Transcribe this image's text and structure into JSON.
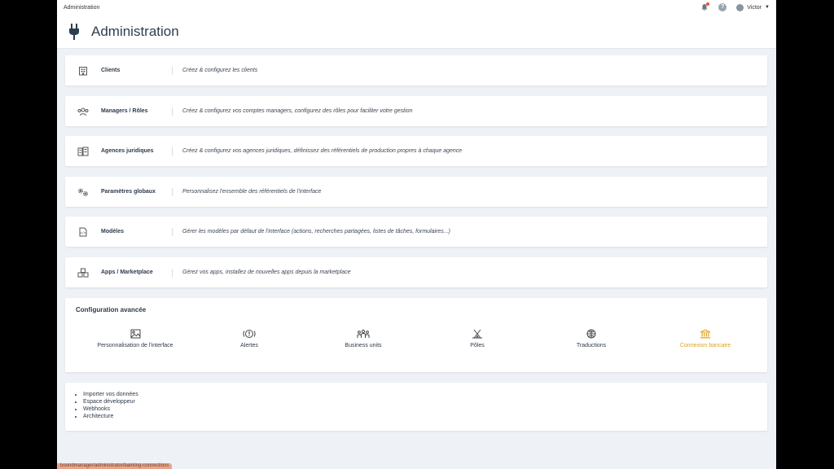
{
  "topbar": {
    "breadcrumb": "Administration",
    "user_name": "Victor",
    "help_label": "?"
  },
  "header": {
    "title": "Administration"
  },
  "sections": [
    {
      "title": "Clients",
      "description": "Créez & configurez les clients",
      "icon": "building-icon"
    },
    {
      "title": "Managers / Rôles",
      "description": "Créez & configurez vos comptes managers, configurez des rôles pour faciliter votre gestion",
      "icon": "users-icon"
    },
    {
      "title": "Agences juridiques",
      "description": "Créez & configurez vos agences juridiques, définissez des référentiels de production propres à chaque agence",
      "icon": "buildings-icon"
    },
    {
      "title": "Paramètres globaux",
      "description": "Personnalisez l'ensemble des référentiels de l'interface",
      "icon": "gears-icon"
    },
    {
      "title": "Modèles",
      "description": "Gérer les modèles par défaut de l'interface (actions, recherches partagées, listes de tâches, formulaires...)",
      "icon": "file-code-icon"
    },
    {
      "title": "Apps / Marketplace",
      "description": "Gérez vos apps, installez de nouvelles apps depuis la marketplace",
      "icon": "boxes-icon"
    }
  ],
  "advanced": {
    "title": "Configuration avancée",
    "items": [
      {
        "label": "Personnalisation de l'interface",
        "icon": "image-icon"
      },
      {
        "label": "Alertes",
        "icon": "alert-icon"
      },
      {
        "label": "Business units",
        "icon": "people-group-icon"
      },
      {
        "label": "Pôles",
        "icon": "tent-icon"
      },
      {
        "label": "Traductions",
        "icon": "globe-icon"
      },
      {
        "label": "Connexion bancaire",
        "icon": "bank-icon",
        "active": true
      }
    ]
  },
  "links": [
    "Importer vos données",
    "Espace développeur",
    "Webhooks",
    "Architecture"
  ],
  "status_url": "boondmanager/administrator/banking-connections",
  "colors": {
    "accent": "#e0a11b",
    "background": "#eef1f6",
    "notification": "#e0533d"
  }
}
